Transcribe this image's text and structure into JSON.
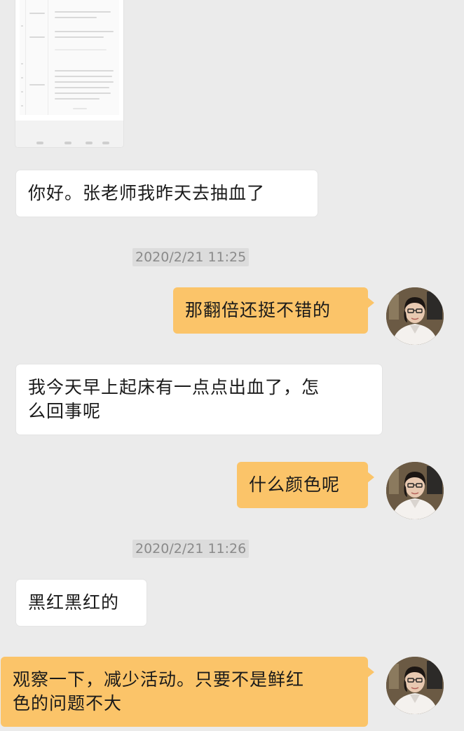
{
  "messages": [
    {
      "type": "image",
      "side": "left",
      "desc": "lab-report-image"
    },
    {
      "type": "text",
      "side": "left",
      "text": "你好。张老师我昨天去抽血了"
    },
    {
      "type": "timestamp",
      "text": "2020/2/21 11:25"
    },
    {
      "type": "text",
      "side": "right",
      "text": "那翻倍还挺不错的"
    },
    {
      "type": "text",
      "side": "left",
      "line1": "我今天早上起床有一点点出血了，怎",
      "line2": "么回事呢"
    },
    {
      "type": "text",
      "side": "right",
      "text": "什么颜色呢"
    },
    {
      "type": "timestamp",
      "text": "2020/2/21 11:26"
    },
    {
      "type": "text",
      "side": "left",
      "text": "黑红黑红的"
    },
    {
      "type": "text",
      "side": "right",
      "line1": "观察一下，减少活动。只要不是鲜红",
      "line2": "色的问题不大"
    }
  ],
  "colors": {
    "background": "#ebebeb",
    "incoming_bubble": "#ffffff",
    "outgoing_bubble": "#fbc469",
    "timestamp_bg": "#dcdcdc",
    "timestamp_text": "#8a8a8a"
  },
  "icons": {
    "avatar": "doctor-avatar-icon"
  }
}
